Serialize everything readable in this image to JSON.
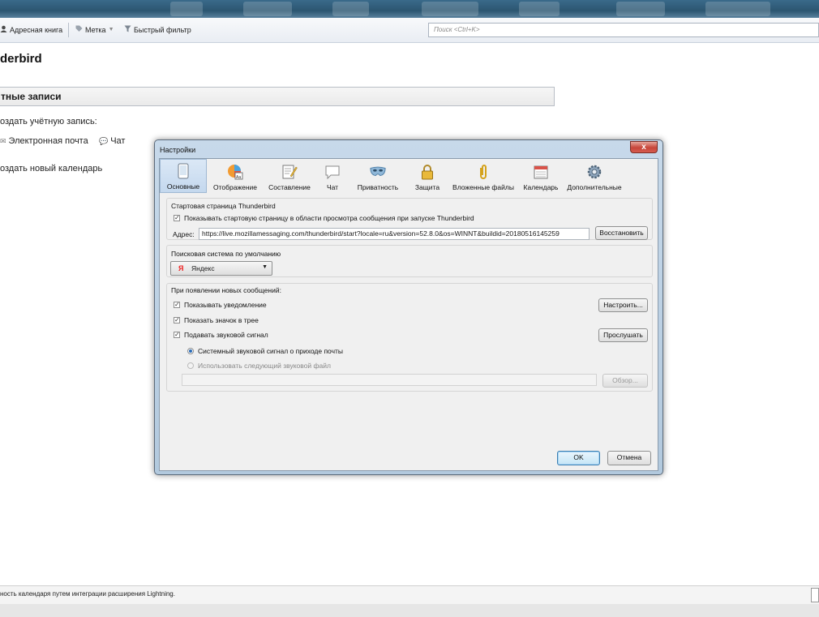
{
  "toolbar": {
    "address_book": "Адресная книга",
    "tag": "Метка",
    "quick_filter": "Быстрый фильтр",
    "search_placeholder": "Поиск <Ctrl+K>"
  },
  "background": {
    "title": "derbird",
    "section_header": "тные записи",
    "create_account": "оздать учётную запись:",
    "account_types": [
      "Электронная почта",
      "Чат"
    ],
    "create_calendar": "оздать новый календарь"
  },
  "statusbar": {
    "text": "ность календаря путем интеграции расширения Lightning."
  },
  "dialog": {
    "title": "Настройки",
    "close_label": "x",
    "tabs": [
      {
        "label": "Основные",
        "icon": "general-icon"
      },
      {
        "label": "Отображение",
        "icon": "display-icon"
      },
      {
        "label": "Составление",
        "icon": "compose-icon"
      },
      {
        "label": "Чат",
        "icon": "chat-icon"
      },
      {
        "label": "Приватность",
        "icon": "privacy-mask-icon"
      },
      {
        "label": "Защита",
        "icon": "lock-icon"
      },
      {
        "label": "Вложенные файлы",
        "icon": "paperclip-icon"
      },
      {
        "label": "Календарь",
        "icon": "calendar-icon"
      },
      {
        "label": "Дополнительные",
        "icon": "gear-icon"
      }
    ],
    "startpage": {
      "group_label": "Стартовая страница Thunderbird",
      "show_label": "Показывать стартовую страницу в области просмотра сообщения при запуске Thunderbird",
      "show_checked": true,
      "address_label": "Адрес:",
      "address_value": "https://live.mozillamessaging.com/thunderbird/start?locale=ru&version=52.8.0&os=WINNT&buildid=20180516145259",
      "restore_button": "Восстановить"
    },
    "search": {
      "group_label": "Поисковая система по умолчанию",
      "engine": "Яндекс"
    },
    "newmail": {
      "group_label": "При появлении новых сообщений:",
      "show_alert": "Показывать уведомление",
      "show_tray": "Показать значок в трее",
      "play_sound": "Подавать звуковой сигнал",
      "configure_button": "Настроить...",
      "listen_button": "Прослушать",
      "system_sound": "Системный звуковой сигнал о приходе почты",
      "custom_sound": "Использовать следующий звуковой файл",
      "browse_button": "Обзор..."
    },
    "ok_button": "OK",
    "cancel_button": "Отмена"
  },
  "colors": {
    "accent": "#2a6cb8",
    "dialog_frame": "#b2c9de",
    "close_button": "#c7463a"
  }
}
